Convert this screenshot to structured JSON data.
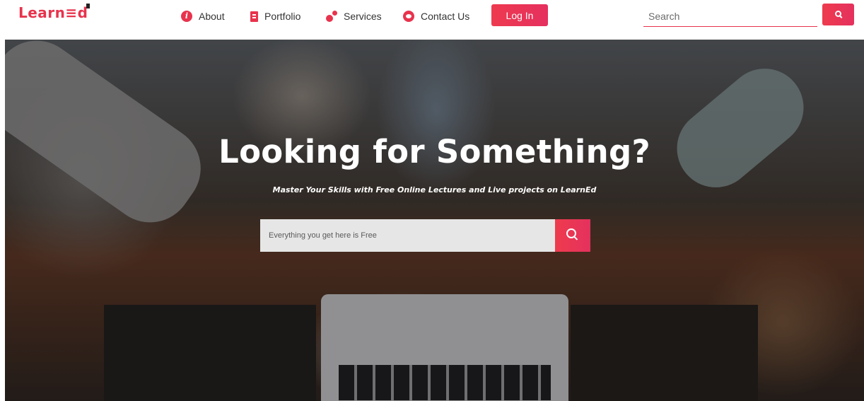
{
  "logo": {
    "text": "Learn",
    "mark": "≡d"
  },
  "nav": {
    "items": [
      {
        "label": "About",
        "icon": "info-icon"
      },
      {
        "label": "Portfolio",
        "icon": "document-icon"
      },
      {
        "label": "Services",
        "icon": "gears-icon"
      },
      {
        "label": "Contact Us",
        "icon": "contact-icon"
      }
    ],
    "login_label": "Log In",
    "search_placeholder": "Search"
  },
  "hero": {
    "title": "Looking for Something?",
    "subtitle": "Master Your Skills with Free Online Lectures and Live projects on LearnEd",
    "search_placeholder": "Everything you get here is Free"
  },
  "colors": {
    "accent": "#e8334d",
    "accent_gradient_end": "#e4315e"
  }
}
